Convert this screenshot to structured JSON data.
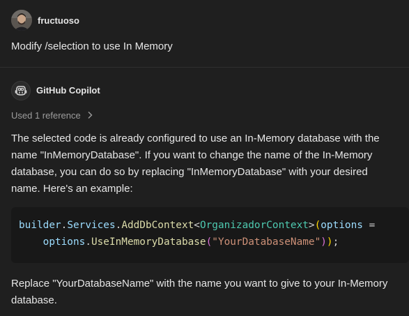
{
  "user_message": {
    "username": "fructuoso",
    "text": "Modify /selection to use In Memory"
  },
  "copilot_message": {
    "name": "GitHub Copilot",
    "references_label": "Used 1 reference",
    "paragraph_1": "The selected code is already configured to use an In-Memory database with the name \"InMemoryDatabase\". If you want to change the name of the In-Memory database, you can do so by replacing \"InMemoryDatabase\" with your desired name. Here's an example:",
    "code_tokens": {
      "builder": "builder",
      "dot1": ".",
      "services": "Services",
      "dot2": ".",
      "adddbcontext": "AddDbContext",
      "lt": "<",
      "organizador_context": "OrganizadorContext",
      "gt": ">",
      "paren_open": "(",
      "options_param": "options",
      "arrow": " =",
      "indent": "    ",
      "options_obj": "options",
      "dot3": ".",
      "use_in_memory": "UseInMemoryDatabase",
      "paren_open2": "(",
      "db_name": "\"YourDatabaseName\"",
      "paren_close2": ")",
      "paren_close": ")",
      "semicolon": ";"
    },
    "paragraph_2": "Replace \"YourDatabaseName\" with the name you want to give to your In-Memory database."
  },
  "colors": {
    "background": "#1f1f1f",
    "code_background": "#181818",
    "variable": "#9cdcfe",
    "function": "#dcdcaa",
    "type": "#4ec9b0",
    "string": "#ce9178",
    "bracket_level1": "#ffd700",
    "bracket_level2": "#da70d6"
  },
  "icons": {
    "user_avatar": "user-avatar-photo",
    "copilot_avatar": "copilot-icon",
    "references_chevron": "chevron-right-icon"
  }
}
